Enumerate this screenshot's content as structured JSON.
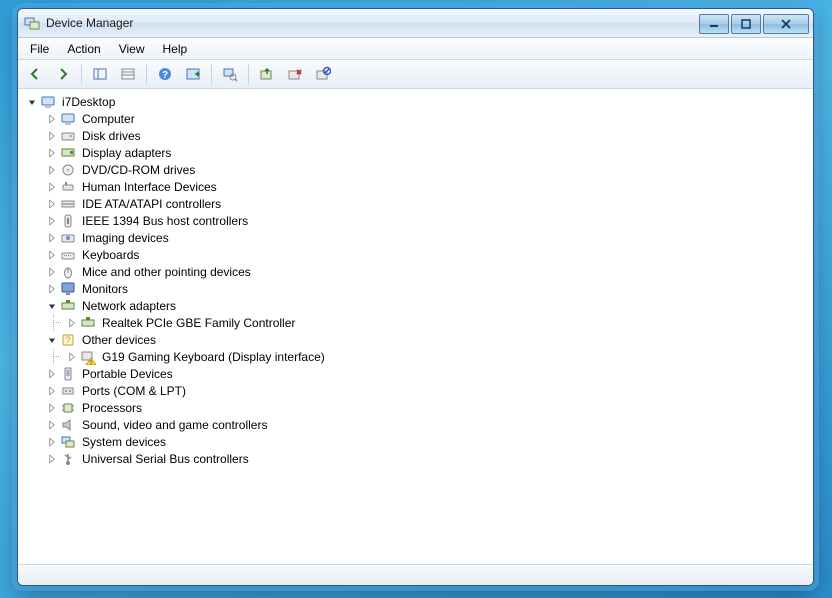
{
  "window": {
    "title": "Device Manager"
  },
  "menu": {
    "file": "File",
    "action": "Action",
    "view": "View",
    "help": "Help"
  },
  "toolbar_icons": {
    "back": "back-icon",
    "forward": "forward-icon",
    "show_hide": "show-hide-tree-icon",
    "props_pane": "properties-pane-icon",
    "help": "help-icon",
    "action": "action-icon",
    "scan": "scan-hardware-icon",
    "update": "update-driver-icon",
    "uninstall": "uninstall-icon",
    "disable": "disable-icon"
  },
  "tree": {
    "root": {
      "label": "i7Desktop",
      "expanded": true,
      "icon": "computer"
    },
    "children": [
      {
        "label": "Computer",
        "icon": "computer",
        "expanded": false
      },
      {
        "label": "Disk drives",
        "icon": "disk",
        "expanded": false
      },
      {
        "label": "Display adapters",
        "icon": "display",
        "expanded": false
      },
      {
        "label": "DVD/CD-ROM drives",
        "icon": "optical",
        "expanded": false
      },
      {
        "label": "Human Interface Devices",
        "icon": "hid",
        "expanded": false
      },
      {
        "label": "IDE ATA/ATAPI controllers",
        "icon": "ide",
        "expanded": false
      },
      {
        "label": "IEEE 1394 Bus host controllers",
        "icon": "1394",
        "expanded": false
      },
      {
        "label": "Imaging devices",
        "icon": "imaging",
        "expanded": false
      },
      {
        "label": "Keyboards",
        "icon": "keyboard",
        "expanded": false
      },
      {
        "label": "Mice and other pointing devices",
        "icon": "mouse",
        "expanded": false
      },
      {
        "label": "Monitors",
        "icon": "monitor",
        "expanded": false
      },
      {
        "label": "Network adapters",
        "icon": "network",
        "expanded": true,
        "children": [
          {
            "label": "Realtek PCIe GBE Family Controller",
            "icon": "network",
            "expanded": false
          }
        ]
      },
      {
        "label": "Other devices",
        "icon": "other",
        "expanded": true,
        "children": [
          {
            "label": "G19 Gaming Keyboard (Display interface)",
            "icon": "warning",
            "expanded": false
          }
        ]
      },
      {
        "label": "Portable Devices",
        "icon": "portable",
        "expanded": false
      },
      {
        "label": "Ports (COM & LPT)",
        "icon": "ports",
        "expanded": false
      },
      {
        "label": "Processors",
        "icon": "cpu",
        "expanded": false
      },
      {
        "label": "Sound, video and game controllers",
        "icon": "sound",
        "expanded": false
      },
      {
        "label": "System devices",
        "icon": "system",
        "expanded": false
      },
      {
        "label": "Universal Serial Bus controllers",
        "icon": "usb",
        "expanded": false
      }
    ]
  }
}
